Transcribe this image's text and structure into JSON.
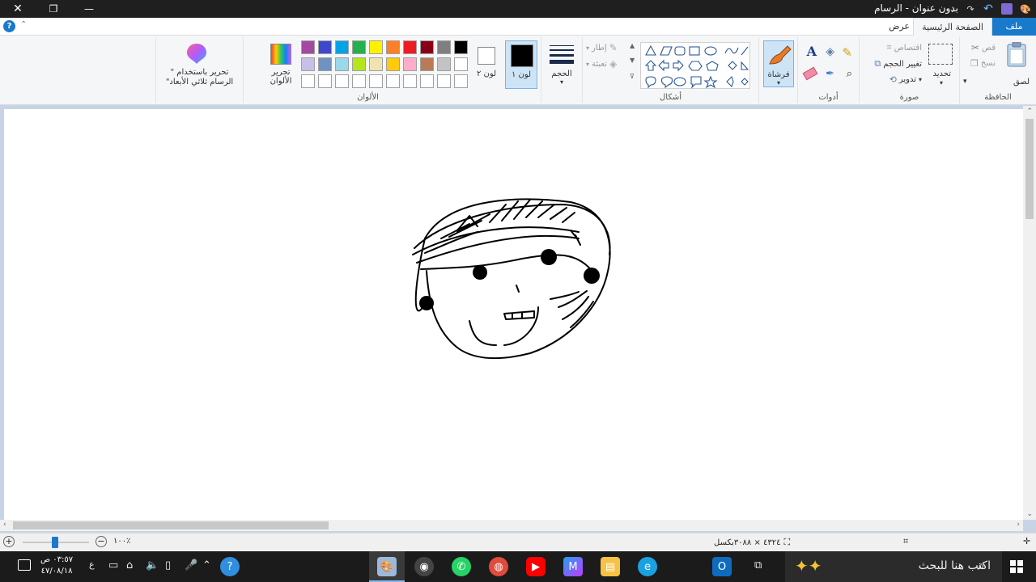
{
  "window": {
    "title": "بدون عنوان - الرسام",
    "minimize": "—",
    "maximize": "❐",
    "close": "✕"
  },
  "tabs": {
    "file": "ملف",
    "home": "الصفحة الرئيسية",
    "view": "عرض"
  },
  "help": "?",
  "clipboard": {
    "label": "الحافظة",
    "paste": "لصق",
    "cut": "قص",
    "copy": "نسخ"
  },
  "image": {
    "label": "صورة",
    "select": "تحديد",
    "crop": "اقتصاص",
    "resize": "تغيير الحجم",
    "rotate": "تدوير"
  },
  "tools": {
    "label": "أدوات"
  },
  "brushes": {
    "label": "فرشاة"
  },
  "shapes": {
    "label": "أشكال",
    "outline": "إطار",
    "fill": "تعبئة"
  },
  "size": {
    "label": "الحجم"
  },
  "colors": {
    "label": "الألوان",
    "color1": "لون ١",
    "color2": "لون ٢",
    "edit_colors": "تحرير الألوان",
    "paint3d": "تحرير باستخدام \" الرسام ثلاثي الأبعاد\"",
    "color1_value": "#000000",
    "color2_value": "#ffffff",
    "palette_row1": [
      "#000000",
      "#7f7f7f",
      "#880015",
      "#ed1c24",
      "#ff7f27",
      "#fff200",
      "#22b14c",
      "#00a2e8",
      "#3f48cc",
      "#a349a4"
    ],
    "palette_row2": [
      "#ffffff",
      "#c3c3c3",
      "#b97a57",
      "#ffaec9",
      "#ffc90e",
      "#efe4b0",
      "#b5e61d",
      "#99d9ea",
      "#7092be",
      "#c8bfe7"
    ]
  },
  "status": {
    "dimensions": "٤٣٢٤ × ٣٠٨٨بكسل",
    "zoom": "١٠٠٪"
  },
  "taskbar": {
    "search_placeholder": "اكتب هنا للبحث",
    "time": "٠٣:٥٧ ص",
    "date": "٤٧/٠٨/١٨",
    "lang": "ع"
  }
}
